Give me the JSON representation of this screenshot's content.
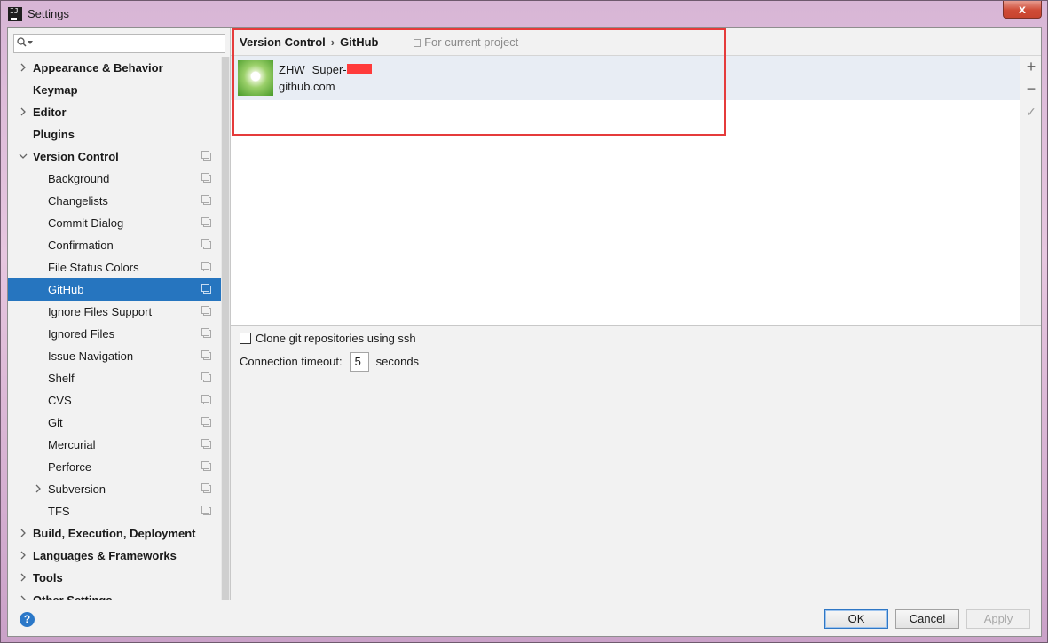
{
  "window": {
    "title": "Settings",
    "close_label": "x",
    "app_icon_text": "IJ"
  },
  "search": {
    "placeholder": "",
    "value": ""
  },
  "tree": {
    "items": [
      {
        "label": "Appearance & Behavior",
        "level": 0,
        "bold": true,
        "chevron": "right",
        "copy": false
      },
      {
        "label": "Keymap",
        "level": 0,
        "bold": true,
        "chevron": "",
        "copy": false
      },
      {
        "label": "Editor",
        "level": 0,
        "bold": true,
        "chevron": "right",
        "copy": false
      },
      {
        "label": "Plugins",
        "level": 0,
        "bold": true,
        "chevron": "",
        "copy": false
      },
      {
        "label": "Version Control",
        "level": 0,
        "bold": true,
        "chevron": "down",
        "copy": true
      },
      {
        "label": "Background",
        "level": 1,
        "bold": false,
        "chevron": "",
        "copy": true
      },
      {
        "label": "Changelists",
        "level": 1,
        "bold": false,
        "chevron": "",
        "copy": true
      },
      {
        "label": "Commit Dialog",
        "level": 1,
        "bold": false,
        "chevron": "",
        "copy": true
      },
      {
        "label": "Confirmation",
        "level": 1,
        "bold": false,
        "chevron": "",
        "copy": true
      },
      {
        "label": "File Status Colors",
        "level": 1,
        "bold": false,
        "chevron": "",
        "copy": true
      },
      {
        "label": "GitHub",
        "level": 1,
        "bold": false,
        "chevron": "",
        "copy": true,
        "selected": true
      },
      {
        "label": "Ignore Files Support",
        "level": 1,
        "bold": false,
        "chevron": "",
        "copy": true
      },
      {
        "label": "Ignored Files",
        "level": 1,
        "bold": false,
        "chevron": "",
        "copy": true
      },
      {
        "label": "Issue Navigation",
        "level": 1,
        "bold": false,
        "chevron": "",
        "copy": true
      },
      {
        "label": "Shelf",
        "level": 1,
        "bold": false,
        "chevron": "",
        "copy": true
      },
      {
        "label": "CVS",
        "level": 1,
        "bold": false,
        "chevron": "",
        "copy": true
      },
      {
        "label": "Git",
        "level": 1,
        "bold": false,
        "chevron": "",
        "copy": true
      },
      {
        "label": "Mercurial",
        "level": 1,
        "bold": false,
        "chevron": "",
        "copy": true
      },
      {
        "label": "Perforce",
        "level": 1,
        "bold": false,
        "chevron": "",
        "copy": true
      },
      {
        "label": "Subversion",
        "level": 1,
        "bold": false,
        "chevron": "right",
        "copy": true
      },
      {
        "label": "TFS",
        "level": 1,
        "bold": false,
        "chevron": "",
        "copy": true
      },
      {
        "label": "Build, Execution, Deployment",
        "level": 0,
        "bold": true,
        "chevron": "right",
        "copy": false
      },
      {
        "label": "Languages & Frameworks",
        "level": 0,
        "bold": true,
        "chevron": "right",
        "copy": false
      },
      {
        "label": "Tools",
        "level": 0,
        "bold": true,
        "chevron": "right",
        "copy": false
      },
      {
        "label": "Other Settings",
        "level": 0,
        "bold": true,
        "chevron": "right",
        "copy": false
      }
    ]
  },
  "breadcrumb": {
    "parent": "Version Control",
    "current": "GitHub",
    "separator": "›",
    "scope_note": "For current project"
  },
  "account": {
    "name": "ZHW",
    "login": "Super-",
    "host": "github.com"
  },
  "account_tools": {
    "add": "+",
    "remove": "−",
    "default": "✓"
  },
  "options": {
    "clone_ssh_label": "Clone git repositories using ssh",
    "clone_ssh_checked": false,
    "timeout_label": "Connection timeout:",
    "timeout_value": "5",
    "timeout_unit": "seconds"
  },
  "buttons": {
    "help": "?",
    "ok": "OK",
    "cancel": "Cancel",
    "apply": "Apply"
  },
  "colors": {
    "selection": "#2675bf",
    "highlight": "#e53b3b",
    "accent": "#2b78c8"
  }
}
